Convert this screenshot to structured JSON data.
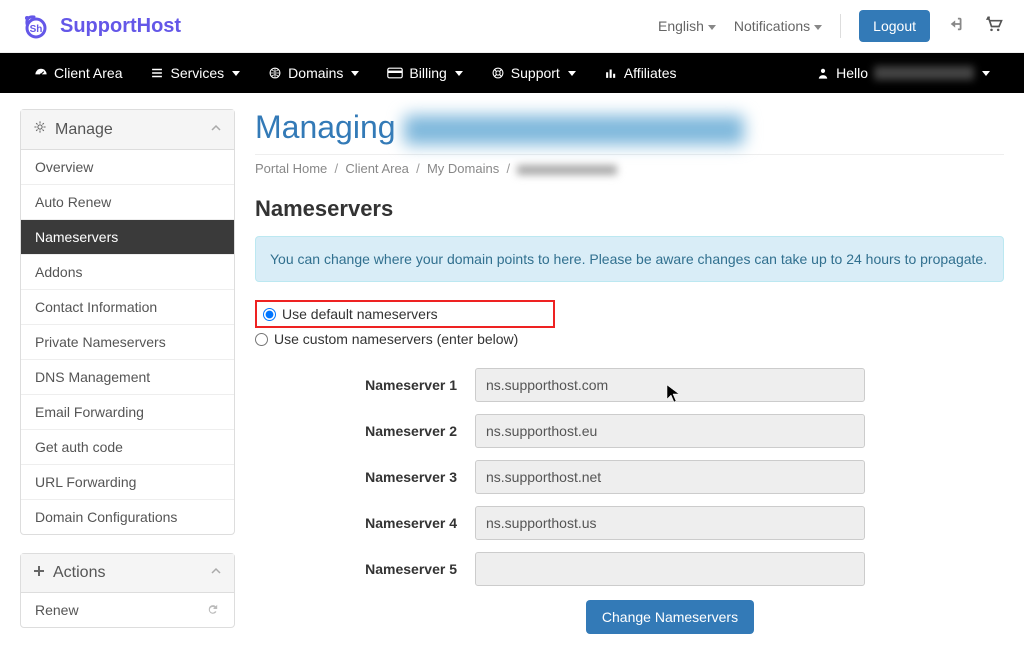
{
  "brand": "SupportHost",
  "topnav": {
    "language": "English",
    "notifications": "Notifications",
    "logout": "Logout"
  },
  "navbar": {
    "client_area": "Client Area",
    "services": "Services",
    "domains": "Domains",
    "billing": "Billing",
    "support": "Support",
    "affiliates": "Affiliates",
    "hello": "Hello"
  },
  "sidebar": {
    "manage_title": "Manage",
    "items": [
      "Overview",
      "Auto Renew",
      "Nameservers",
      "Addons",
      "Contact Information",
      "Private Nameservers",
      "DNS Management",
      "Email Forwarding",
      "Get auth code",
      "URL Forwarding",
      "Domain Configurations"
    ],
    "actions_title": "Actions",
    "actions": [
      "Renew"
    ]
  },
  "content": {
    "title_prefix": "Managing ",
    "breadcrumb": {
      "home": "Portal Home",
      "client": "Client Area",
      "domains": "My Domains"
    },
    "section_title": "Nameservers",
    "alert": "You can change where your domain points to here. Please be aware changes can take up to 24 hours to propagate.",
    "radio_default": "Use default nameservers",
    "radio_custom": "Use custom nameservers (enter below)",
    "ns_labels": [
      "Nameserver 1",
      "Nameserver 2",
      "Nameserver 3",
      "Nameserver 4",
      "Nameserver 5"
    ],
    "ns_values": [
      "ns.supporthost.com",
      "ns.supporthost.eu",
      "ns.supporthost.net",
      "ns.supporthost.us",
      ""
    ],
    "submit": "Change Nameservers"
  }
}
